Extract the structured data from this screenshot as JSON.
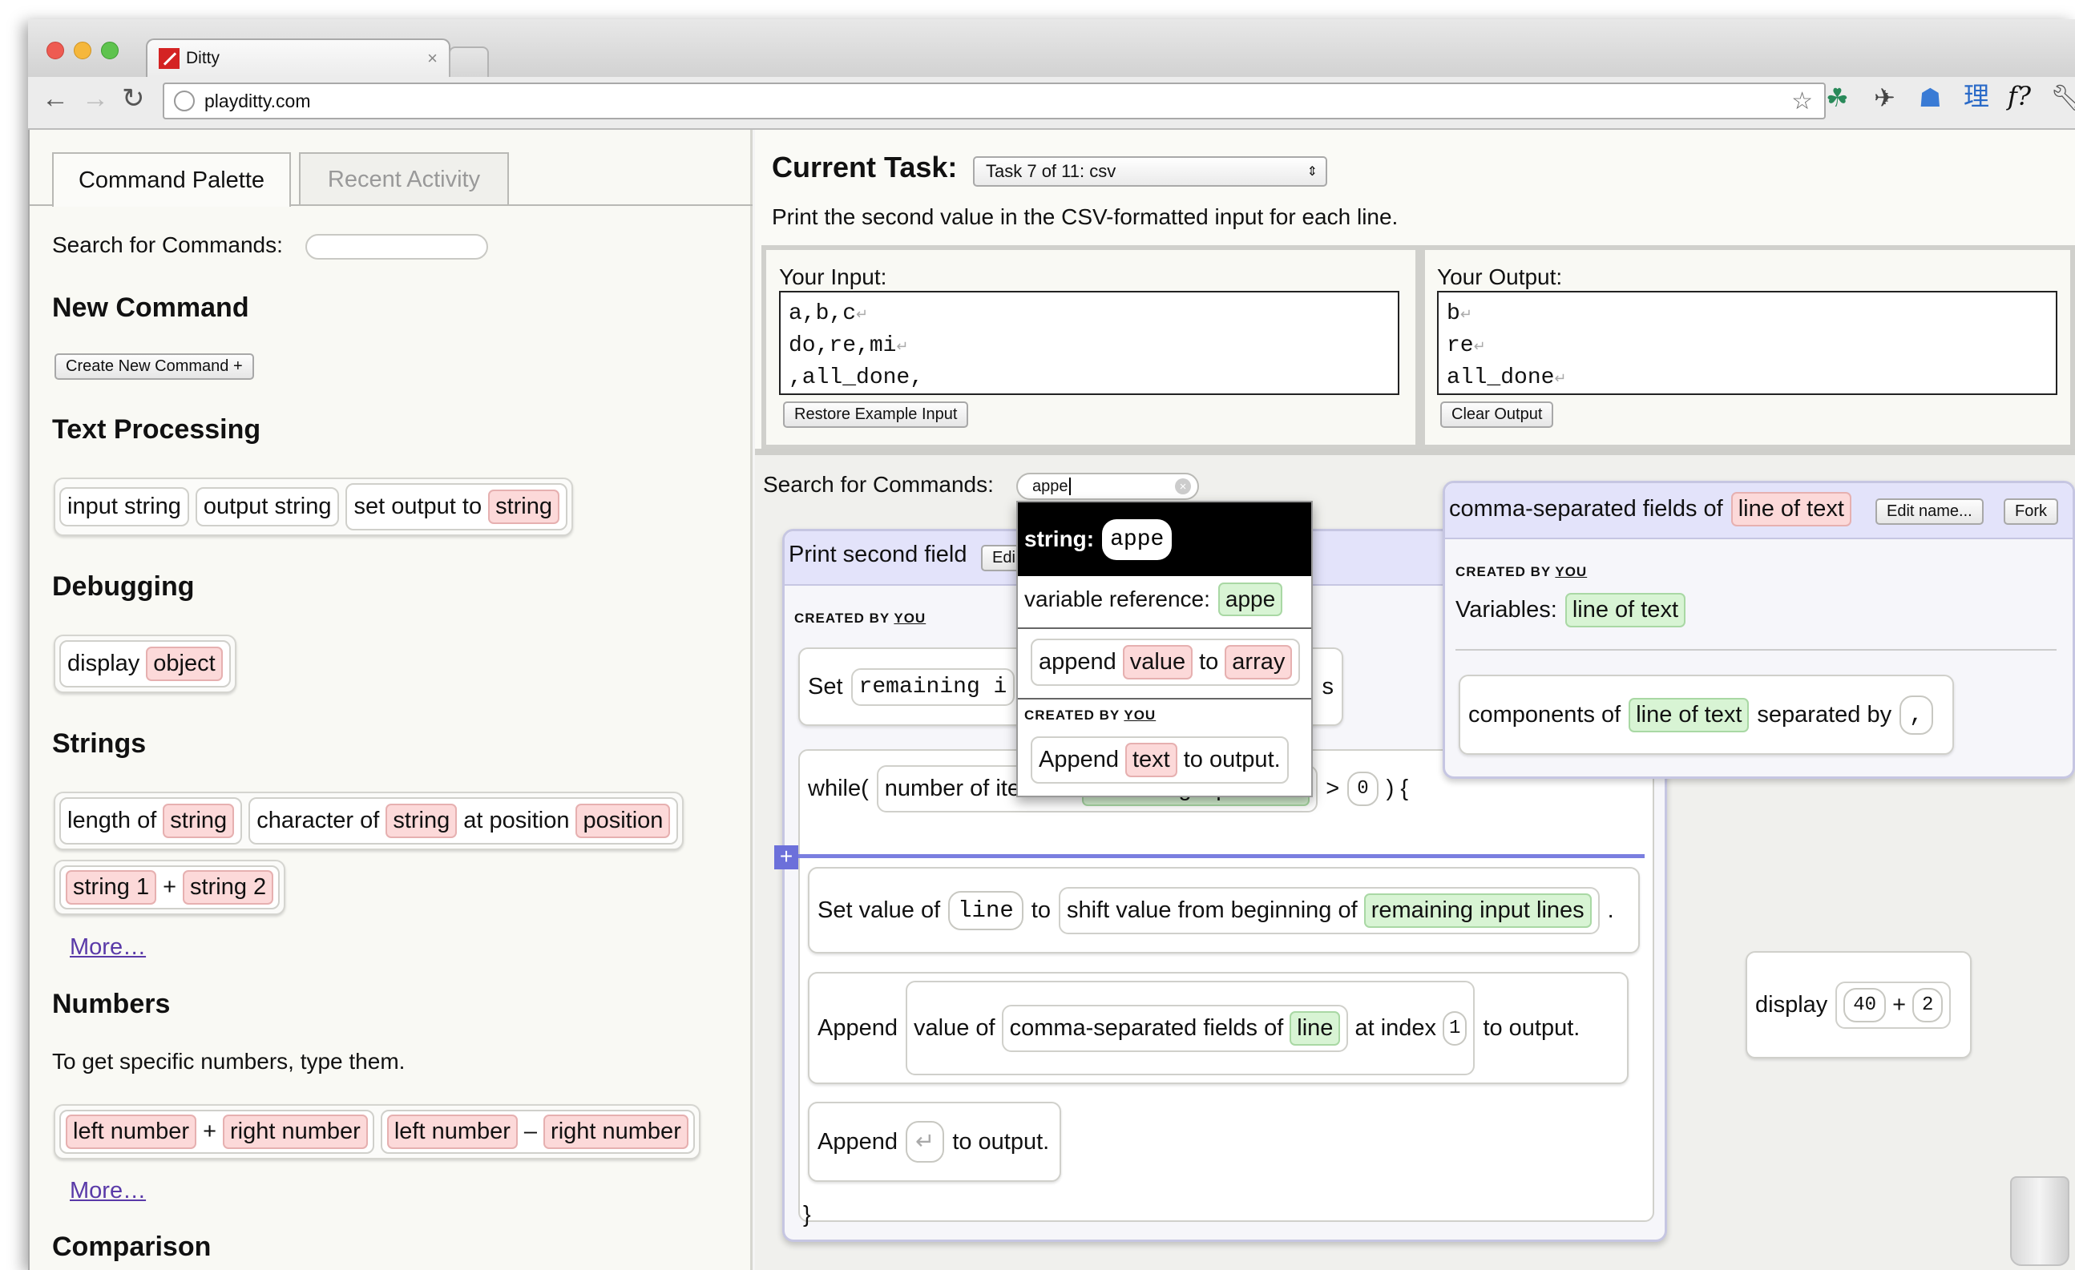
{
  "browser": {
    "tab_title": "Ditty",
    "url": "playditty.com",
    "ext_extra": "理",
    "ext_fq": "f?"
  },
  "palette": {
    "tabs": [
      "Command Palette",
      "Recent Activity"
    ],
    "search_label": "Search for Commands:",
    "search_value": "",
    "new_command_heading": "New Command",
    "create_new_button": "Create New Command +",
    "text_processing_heading": "Text Processing",
    "input_string": "input string",
    "output_string": "output string",
    "set_output_to": "set output to",
    "string": "string",
    "debugging_heading": "Debugging",
    "display": "display",
    "object": "object",
    "strings_heading": "Strings",
    "length_of": "length of",
    "character_of": "character of",
    "at_position": "at position",
    "position": "position",
    "string1": "string 1",
    "plus": "+",
    "string2": "string 2",
    "more": "More…",
    "numbers_heading": "Numbers",
    "numbers_hint": "To get specific numbers, type them.",
    "left_number": "left number",
    "right_number": "right number",
    "minus": "–",
    "comparison_heading": "Comparison"
  },
  "task": {
    "label": "Current Task:",
    "selected": "Task 7 of 11: csv",
    "description": "Print the second value in the CSV-formatted input for each line.",
    "input_label": "Your Input:",
    "input_lines": [
      "a,b,c",
      "do,re,mi",
      ",all_done,"
    ],
    "restore_button": "Restore Example Input",
    "output_label": "Your Output:",
    "output_lines": [
      "b",
      "re",
      "all_done"
    ],
    "clear_button": "Clear Output"
  },
  "workspace": {
    "search_label": "Search for Commands:",
    "search_value": "appe",
    "dropdown": {
      "string_label": "string:",
      "string_value": "appe",
      "varref_label": "variable reference:",
      "varref_value": "appe",
      "append": "append",
      "value": "value",
      "to": "to",
      "array": "array",
      "created_by": "CREATED BY",
      "you": "YOU",
      "append2": "Append",
      "text": "text",
      "to_output": "to output."
    },
    "main_fn": {
      "title": "Print second field",
      "edit_partial": "Edi",
      "created_by": "CREATED BY",
      "you": "YOU",
      "set": "Set",
      "remaining_partial": "remaining i",
      "trailing_partial": "s",
      "while": "while(",
      "number_of_items_in": "number of items in",
      "remaining_input_lines": "remaining input lines",
      "gt": ">",
      "zero": "0",
      "brace_open": ") {",
      "set_value_of": "Set value of",
      "line": "line",
      "to": "to",
      "shift_value": "shift value from beginning of",
      "append": "Append",
      "value_of": "value of",
      "csf_of": "comma-separated fields of",
      "at_index": "at index",
      "one": "1",
      "to_output": "to output.",
      "newline_glyph": "↵",
      "brace_close": "}"
    },
    "csf_fn": {
      "title": "comma-separated fields of",
      "param": "line of text",
      "edit_name_button": "Edit name...",
      "fork_button": "Fork",
      "created_by": "CREATED BY",
      "you": "YOU",
      "variables_label": "Variables:",
      "components_of": "components of",
      "separated_by": "separated by",
      "comma": ","
    },
    "display_block": {
      "display": "display",
      "a": "40",
      "plus": "+",
      "b": "2"
    }
  }
}
